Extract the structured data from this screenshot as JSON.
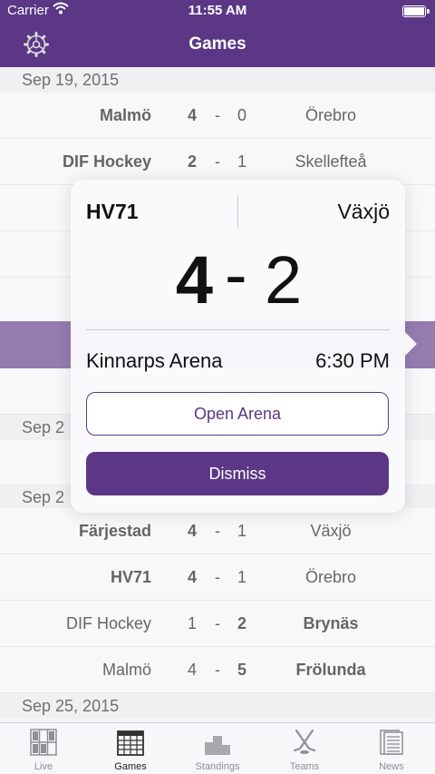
{
  "status": {
    "carrier": "Carrier",
    "time": "11:55 AM"
  },
  "nav": {
    "title": "Games"
  },
  "sections": [
    {
      "date": "Sep 19, 2015"
    },
    {
      "date": "Sep 2"
    },
    {
      "date": "Sep 2"
    },
    {
      "date": "Sep 25, 2015"
    }
  ],
  "games": [
    {
      "home": "Malmö",
      "home_score": "4",
      "away_score": "0",
      "away": "Örebro",
      "winner": "home"
    },
    {
      "home": "DIF Hockey",
      "home_score": "2",
      "away_score": "1",
      "away": "Skellefteå",
      "winner": "home"
    },
    {
      "home": "Färjestad",
      "home_score": "4",
      "away_score": "1",
      "away": "Växjö",
      "winner": "home"
    },
    {
      "home": "HV71",
      "home_score": "4",
      "away_score": "1",
      "away": "Örebro",
      "winner": "home"
    },
    {
      "home": "DIF Hockey",
      "home_score": "1",
      "away_score": "2",
      "away": "Brynäs",
      "winner": "away"
    },
    {
      "home": "Malmö",
      "home_score": "4",
      "away_score": "5",
      "away": "Frölunda",
      "winner": "away"
    }
  ],
  "separator": "-",
  "popover": {
    "home": "HV71",
    "away": "Växjö",
    "home_score": "4",
    "away_score": "2",
    "dash": "-",
    "arena": "Kinnarps Arena",
    "time": "6:30 PM",
    "open_button": "Open Arena",
    "dismiss_button": "Dismiss"
  },
  "tabs": [
    {
      "label": "Live",
      "icon": "scoreboard-icon",
      "active": false
    },
    {
      "label": "Games",
      "icon": "calendar-icon",
      "active": true
    },
    {
      "label": "Standings",
      "icon": "podium-icon",
      "active": false
    },
    {
      "label": "Teams",
      "icon": "hockey-sticks-icon",
      "active": false
    },
    {
      "label": "News",
      "icon": "newspaper-icon",
      "active": false
    }
  ],
  "colors": {
    "accent": "#5b3785",
    "list_bg": "#f4f3f6",
    "header_bg": "#e9e6ec"
  }
}
